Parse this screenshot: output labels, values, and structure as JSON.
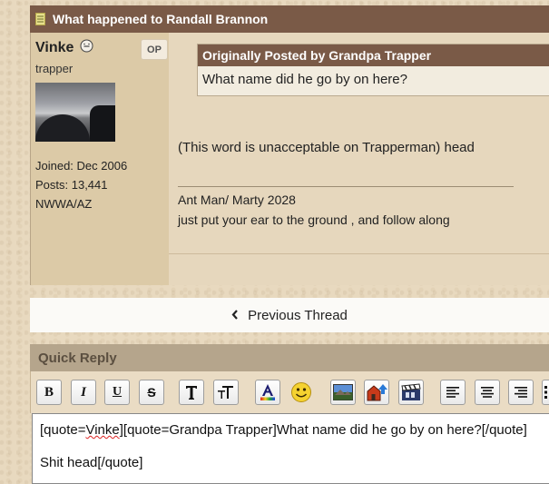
{
  "post": {
    "title": "What happened to Randall Brannon",
    "username": "Vinke",
    "op_badge": "OP",
    "user_title": "trapper",
    "joined": "Joined: Dec 2006",
    "posts": "Posts: 13,441",
    "location": "NWWA/AZ",
    "quote": {
      "header": "Originally Posted by Grandpa Trapper",
      "text": "What name did he go by on here?"
    },
    "message": "(This word is unacceptable on Trapperman) head",
    "signature": [
      "Ant Man/ Marty 2028",
      "just put your ear to the ground , and follow along"
    ]
  },
  "nav": {
    "previous_thread": "Previous Thread"
  },
  "quick_reply": {
    "title": "Quick Reply",
    "editor_line1_prefix": "[quote=",
    "editor_line1_user": "Vinke",
    "editor_line1_rest": "][quote=Grandpa Trapper]What name did he go by on here?[/quote]",
    "editor_line2": "Shit head[/quote]"
  },
  "toolbar": {
    "bold": "B",
    "italic": "I",
    "underline": "U",
    "strike": "S"
  },
  "colors": {
    "header_brown": "#7a5a47",
    "panel_tan": "#e6d7bd",
    "user_col": "#dccaa7",
    "quick_reply_header": "#b5a58c"
  }
}
